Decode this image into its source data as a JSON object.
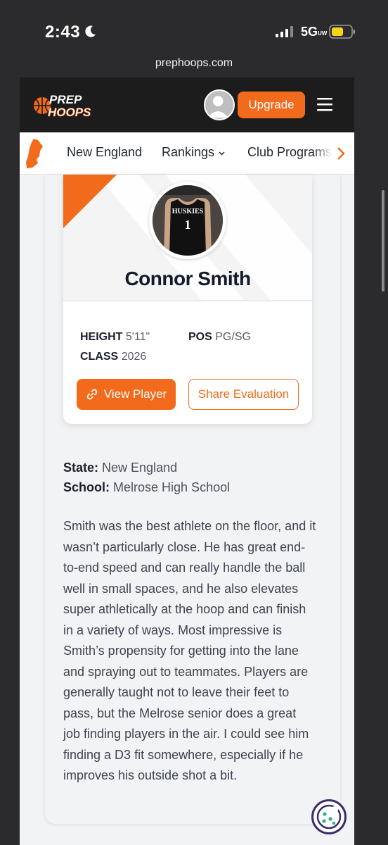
{
  "status": {
    "time": "2:43",
    "network": "5G",
    "network_sub": "UW",
    "icons": [
      "moon-icon",
      "signal-icon",
      "battery-icon"
    ]
  },
  "browser": {
    "url": "prephoops.com"
  },
  "header": {
    "logo_top": "PREP",
    "logo_bottom": "HOOPS",
    "upgrade_label": "Upgrade",
    "brand_color": "#f26a1b"
  },
  "subnav": {
    "items": [
      {
        "label": "New England"
      },
      {
        "label": "Rankings"
      },
      {
        "label": "Club Programs"
      }
    ]
  },
  "player": {
    "name": "Connor Smith",
    "jersey_text": "HUSKIES",
    "jersey_number": "1",
    "height_label": "HEIGHT",
    "height": "5'11\"",
    "pos_label": "POS",
    "pos": "PG/SG",
    "class_label": "CLASS",
    "class": "2026",
    "view_label": "View Player",
    "share_label": "Share Evaluation"
  },
  "details": {
    "state_label": "State:",
    "state": "New England",
    "school_label": "School:",
    "school": "Melrose High School",
    "evaluation": "Smith was the best athlete on the floor, and it wasn’t particularly close. He has great end-to-end speed and can really handle the ball well in small spaces, and he also elevates super athletically at the hoop and can finish in a variety of ways. Most impressive is Smith’s propensity for getting into the lane and spraying out to teammates. Players are generally taught not to leave their feet to pass, but the Melrose senior does a great job finding players in the air. I could see him finding a D3 fit somewhere, especially if he improves his outside shot a bit."
  }
}
